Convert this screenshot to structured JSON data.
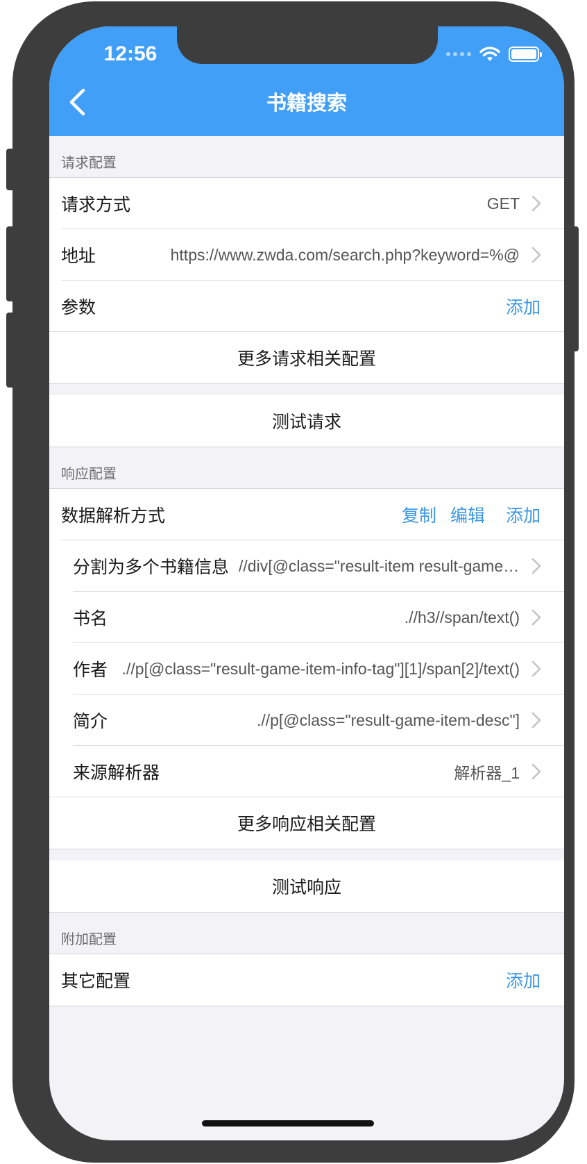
{
  "status_bar": {
    "time": "12:56"
  },
  "nav": {
    "title": "书籍搜索",
    "back_icon": "chevron-left-icon"
  },
  "request_section": {
    "header": "请求配置",
    "method": {
      "label": "请求方式",
      "value": "GET"
    },
    "url": {
      "label": "地址",
      "value": "https://www.zwda.com/search.php?keyword=%@"
    },
    "params": {
      "label": "参数",
      "action": "添加"
    },
    "more": "更多请求相关配置",
    "test": "测试请求"
  },
  "response_section": {
    "header": "响应配置",
    "parse_mode": {
      "label": "数据解析方式",
      "copy": "复制",
      "edit": "编辑",
      "add": "添加"
    },
    "split": {
      "label": "分割为多个书籍信息",
      "value": "//div[@class=\"result-item result-game-item\"]"
    },
    "book_name": {
      "label": "书名",
      "value": ".//h3//span/text()"
    },
    "author": {
      "label": "作者",
      "value": ".//p[@class=\"result-game-item-info-tag\"][1]/span[2]/text()"
    },
    "intro": {
      "label": "简介",
      "value": ".//p[@class=\"result-game-item-desc\"]"
    },
    "source_parser": {
      "label": "来源解析器",
      "value": "解析器_1"
    },
    "more": "更多响应相关配置",
    "test": "测试响应"
  },
  "extra_section": {
    "header": "附加配置",
    "other": {
      "label": "其它配置",
      "action": "添加"
    }
  },
  "colors": {
    "nav_bar": "#429ff7",
    "link": "#3a97e6",
    "background": "#f2f2f7"
  }
}
